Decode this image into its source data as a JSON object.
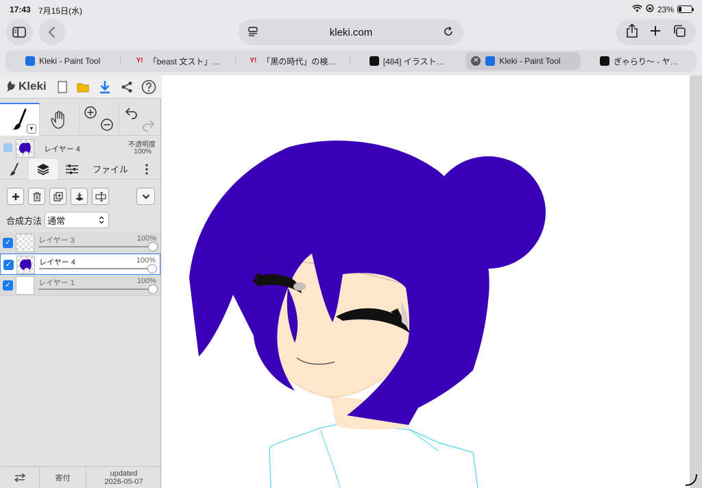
{
  "status_bar": {
    "time": "17:43",
    "date": "7月15日(水)",
    "battery": "23%",
    "battery_level": 0.23
  },
  "browser": {
    "url": "kleki.com"
  },
  "tabs": [
    {
      "title": "Kleki - Paint Tool",
      "favicon": "kleki-icon",
      "active": false
    },
    {
      "title": "「beast 文スト」…",
      "favicon": "yahoo-icon",
      "active": false
    },
    {
      "title": "「黒の時代」の検…",
      "favicon": "yahoo-icon",
      "active": false
    },
    {
      "title": "[484] イラスト…",
      "favicon": "black-square-icon",
      "active": false
    },
    {
      "title": "Kleki - Paint Tool",
      "favicon": "kleki-icon",
      "active": true
    },
    {
      "title": "ぎゃらり〜 - ヤ…",
      "favicon": "moon-icon",
      "active": false
    }
  ],
  "app": {
    "logo": "Kleki",
    "current_layer": {
      "name": "レイヤー 4",
      "opacity_label": "不透明度",
      "opacity": "100%"
    },
    "panel_tabs": {
      "file": "ファイル"
    },
    "blend": {
      "label": "合成方法",
      "value": "通常"
    },
    "layers": [
      {
        "name": "レイヤー 3",
        "opacity": "100%",
        "visible": true,
        "active": false
      },
      {
        "name": "レイヤー 4",
        "opacity": "100%",
        "visible": true,
        "active": true
      },
      {
        "name": "レイヤー 1",
        "opacity": "100%",
        "visible": true,
        "active": false
      }
    ],
    "footer": {
      "donate": "寄付",
      "updated_label": "updated",
      "updated_date": "2026-05-07"
    }
  },
  "colors": {
    "accent": "#3b82f6",
    "hair": "#3a00b8",
    "skin": "#fde6cb",
    "outline_cyan": "#4fd6ea"
  }
}
